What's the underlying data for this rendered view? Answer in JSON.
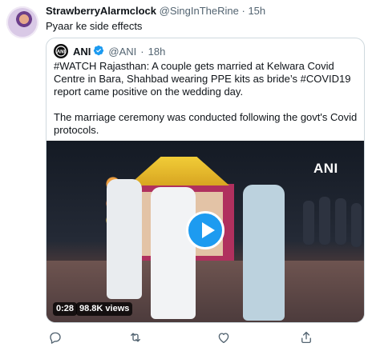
{
  "tweet": {
    "display_name": "StrawberryAlarmclock",
    "handle": "@SingInTheRine",
    "separator": "·",
    "time": "15h",
    "text": "Pyaar ke side effects"
  },
  "quote": {
    "display_name": "ANI",
    "handle": "@ANI",
    "separator": "·",
    "time": "18h",
    "paragraph1": "#WATCH Rajasthan: A couple gets married at Kelwara Covid Centre in Bara, Shahbad wearing PPE kits as bride’s #COVID19 report came positive on the wedding day.",
    "paragraph2": "The marriage ceremony was conducted following the govt's Covid protocols.",
    "media": {
      "watermark": "ANI",
      "duration": "0:28",
      "views": "98.8K views"
    }
  },
  "icons": [
    "reply-icon",
    "retweet-icon",
    "like-icon",
    "share-icon",
    "play-icon",
    "verified-badge-icon"
  ],
  "colors": {
    "accent": "#1d9bf0",
    "text": "#0f1419",
    "secondary": "#536471",
    "border": "#cfd9de"
  }
}
